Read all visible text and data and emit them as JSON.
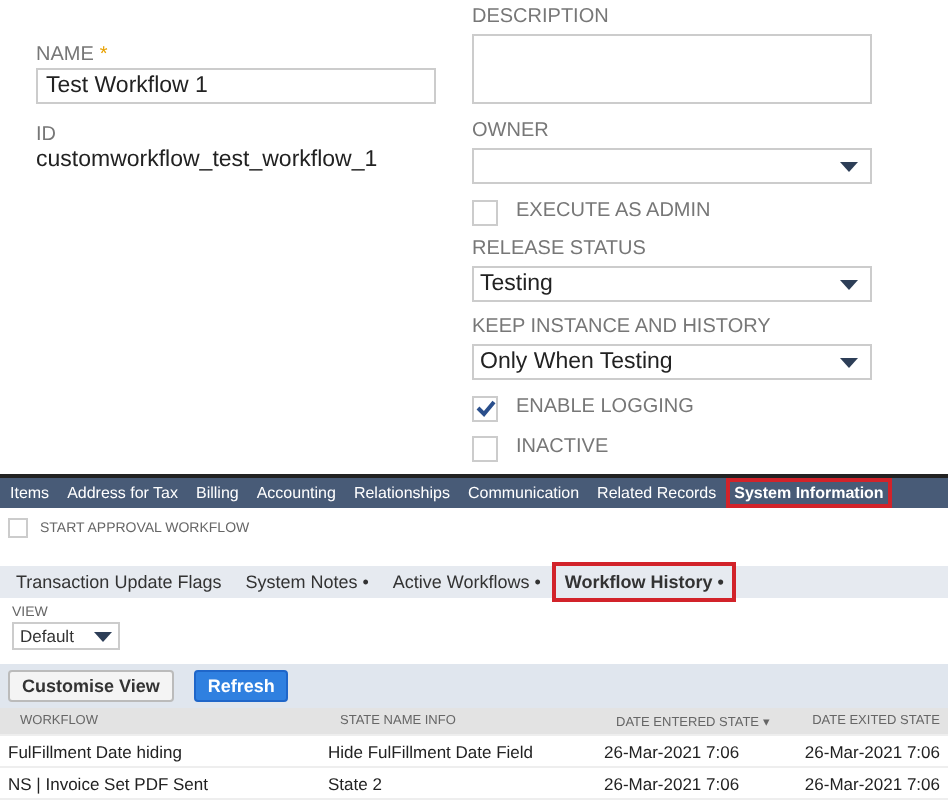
{
  "form": {
    "name": {
      "label": "NAME",
      "required": "*",
      "value": "Test Workflow 1"
    },
    "id": {
      "label": "ID",
      "value": "customworkflow_test_workflow_1"
    },
    "right": [
      {
        "kind": "textarea",
        "label": "DESCRIPTION"
      },
      {
        "kind": "select",
        "label": "OWNER"
      },
      {
        "kind": "checkbox",
        "label": "EXECUTE AS ADMIN",
        "checked": false
      },
      {
        "kind": "select",
        "label": "RELEASE STATUS",
        "value": "Testing"
      },
      {
        "kind": "select",
        "label": "KEEP INSTANCE AND HISTORY",
        "value": "Only When Testing"
      },
      {
        "kind": "checkbox",
        "label": "ENABLE LOGGING",
        "checked": true
      },
      {
        "kind": "checkbox",
        "label": "INACTIVE",
        "checked": false
      }
    ]
  },
  "tabs": [
    {
      "label": "Items",
      "selected": false,
      "highlighted": false
    },
    {
      "label": "Address for Tax",
      "selected": false,
      "highlighted": false
    },
    {
      "label": "Billing",
      "selected": false,
      "highlighted": false
    },
    {
      "label": "Accounting",
      "selected": false,
      "highlighted": false
    },
    {
      "label": "Relationships",
      "selected": false,
      "highlighted": false
    },
    {
      "label": "Communication",
      "selected": false,
      "highlighted": false
    },
    {
      "label": "Related Records",
      "selected": false,
      "highlighted": false
    },
    {
      "label": "System Information",
      "selected": true,
      "highlighted": true
    }
  ],
  "approval": {
    "label": "START APPROVAL WORKFLOW",
    "checked": false
  },
  "subtabs": [
    {
      "label": "Transaction Update Flags",
      "selected": false,
      "highlighted": false
    },
    {
      "label": "System Notes",
      "dot": "•",
      "selected": false,
      "highlighted": false
    },
    {
      "label": "Active Workflows",
      "dot": "•",
      "selected": false,
      "highlighted": false
    },
    {
      "label": "Workflow History",
      "dot": "•",
      "selected": true,
      "highlighted": true
    }
  ],
  "view": {
    "label": "VIEW",
    "value": "Default"
  },
  "buttons": [
    {
      "label": "Customise View",
      "kind": "secondary"
    },
    {
      "label": "Refresh",
      "kind": "primary"
    }
  ],
  "table": {
    "columns": [
      "WORKFLOW",
      "STATE NAME INFO",
      "DATE ENTERED STATE ▾",
      "DATE EXITED STATE"
    ],
    "rows": [
      [
        "FulFillment Date hiding",
        "Hide FulFillment Date Field",
        "26-Mar-2021 7:06",
        "26-Mar-2021 7:06"
      ],
      [
        "NS | Invoice Set PDF Sent",
        "State 2",
        "26-Mar-2021 7:06",
        "26-Mar-2021 7:06"
      ]
    ]
  }
}
